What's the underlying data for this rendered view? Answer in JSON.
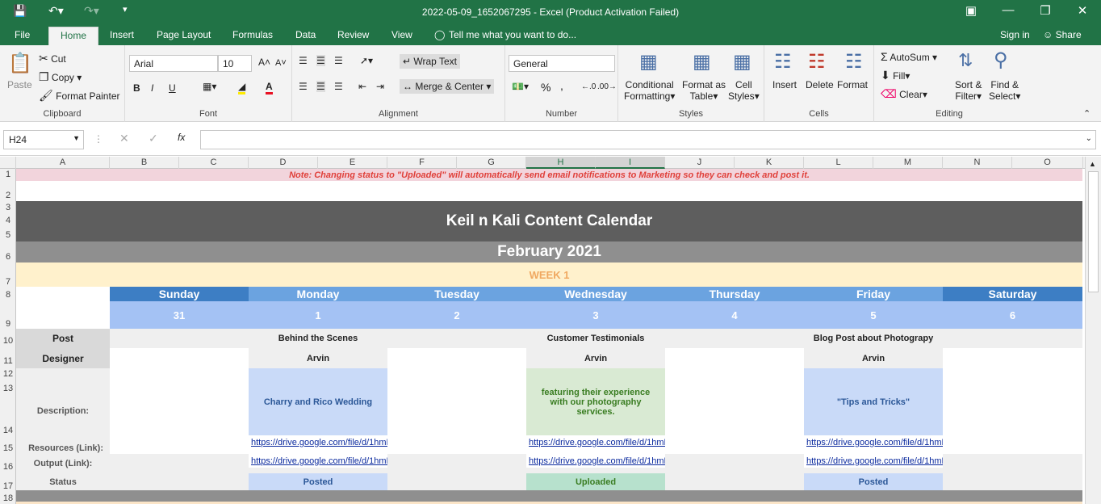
{
  "title": "2022-05-09_1652067295 - Excel (Product Activation Failed)",
  "tabs": [
    "File",
    "Home",
    "Insert",
    "Page Layout",
    "Formulas",
    "Data",
    "Review",
    "View"
  ],
  "tell_me": "Tell me what you want to do...",
  "sign_in": "Sign in",
  "share": "Share",
  "ribbon": {
    "paste": "Paste",
    "cut": "Cut",
    "copy": "Copy",
    "format_painter": "Format Painter",
    "clipboard": "Clipboard",
    "font_name": "Arial",
    "font_size": "10",
    "font": "Font",
    "wrap_text": "Wrap Text",
    "merge_center": "Merge & Center",
    "alignment": "Alignment",
    "number_format": "General",
    "number": "Number",
    "cond_fmt_1": "Conditional",
    "cond_fmt_2": "Formatting",
    "fmt_table_1": "Format as",
    "fmt_table_2": "Table",
    "cell_styles_1": "Cell",
    "cell_styles_2": "Styles",
    "styles": "Styles",
    "insert": "Insert",
    "delete": "Delete",
    "format": "Format",
    "cells": "Cells",
    "autosum": "AutoSum",
    "fill": "Fill",
    "clear": "Clear",
    "sort_1": "Sort &",
    "sort_2": "Filter",
    "find_1": "Find &",
    "find_2": "Select",
    "editing": "Editing",
    "bold": "B",
    "italic": "I",
    "underline": "U",
    "percent": "%",
    "comma": ",",
    "fx": "fx"
  },
  "name_box": "H24",
  "columns": [
    "A",
    "B",
    "C",
    "D",
    "E",
    "F",
    "G",
    "H",
    "I",
    "J",
    "K",
    "L",
    "M",
    "N",
    "O"
  ],
  "rows": [
    "1",
    "2",
    "3",
    "4",
    "5",
    "6",
    "7",
    "8",
    "9",
    "10",
    "11",
    "12",
    "13",
    "14",
    "15",
    "16",
    "17",
    "18"
  ],
  "sheet": {
    "note": "Note: Changing status to \"Uploaded\" will automatically send email notifications to Marketing so they can check and post it.",
    "title": "Keil n Kali Content Calendar",
    "month": "February 2021",
    "week": "WEEK 1",
    "days": [
      "Sunday",
      "Monday",
      "Tuesday",
      "Wednesday",
      "Thursday",
      "Friday",
      "Saturday"
    ],
    "dates": [
      "31",
      "1",
      "2",
      "3",
      "4",
      "5",
      "6"
    ],
    "labels": {
      "post": "Post",
      "designer": "Designer",
      "description": "Description:",
      "resources": "Resources (Link):",
      "output": "Output (Link):",
      "status": "Status"
    },
    "mon": {
      "post": "Behind the Scenes",
      "designer": "Arvin",
      "desc": "Charry and Rico Wedding",
      "res": "https://drive.google.com/file/d/1hmL",
      "out": "https://drive.google.com/file/d/1hmL",
      "status": "Posted"
    },
    "wed": {
      "post": "Customer Testimonials",
      "designer": "Arvin",
      "desc": "featuring their experience with our photography services.",
      "res": "https://drive.google.com/file/d/1hmL",
      "out": "https://drive.google.com/file/d/1hmL",
      "status": "Uploaded"
    },
    "fri": {
      "post": "Blog Post about Photograpy",
      "designer": "Arvin",
      "desc": "\"Tips and Tricks\"",
      "res": "https://drive.google.com/file/d/1hmL",
      "out": "https://drive.google.com/file/d/1hmL",
      "status": "Posted"
    }
  }
}
